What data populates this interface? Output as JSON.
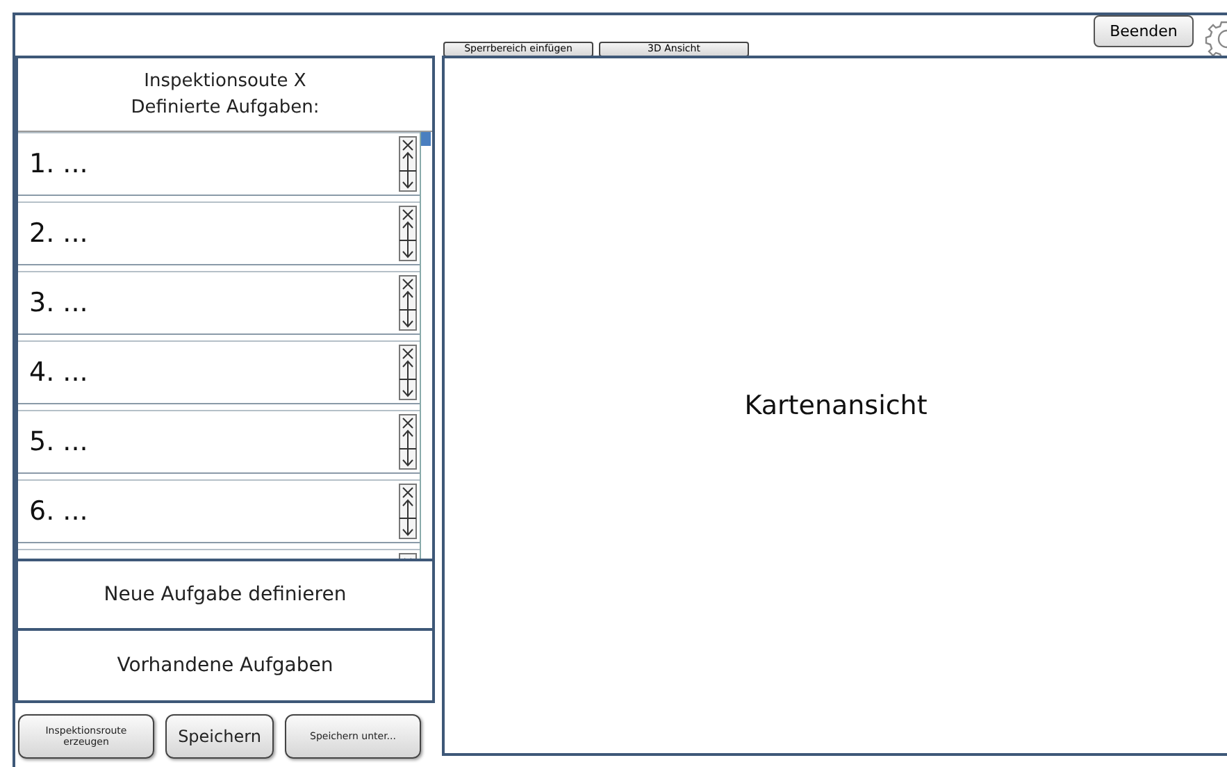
{
  "toolbar": {
    "buttons": [
      "Sperrbereich einfügen",
      "3D Ansicht"
    ],
    "exit_button": "Beenden"
  },
  "task_panel": {
    "title_lines": [
      "Inspektionsoute X",
      "Definierte Aufgaben:"
    ],
    "tasks": [
      {
        "label": "1. ..."
      },
      {
        "label": "2. ..."
      },
      {
        "label": "3. ..."
      },
      {
        "label": "4. ..."
      },
      {
        "label": "5. ..."
      },
      {
        "label": "6. ..."
      }
    ],
    "actions": [
      "Neue Aufgabe definieren",
      "Vorhandene Aufgaben"
    ]
  },
  "bottom_buttons": [
    {
      "label": "Inspektionsroute erzeugen",
      "kind": "small"
    },
    {
      "label": "Speichern",
      "kind": "large"
    },
    {
      "label": "Speichern unter...",
      "kind": "small"
    }
  ],
  "map": {
    "label": "Kartenansicht"
  }
}
